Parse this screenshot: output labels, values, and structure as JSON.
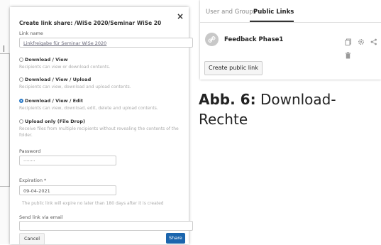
{
  "modal": {
    "title": "Create link share: /WiSe 2020/Seminar WiSe 20",
    "close_glyph": "×",
    "link_name_label": "Link name",
    "link_name_value": "Linkfreigabe für Seminar WiSe 2020",
    "options": [
      {
        "name": "Download / View",
        "desc": "Recipients can view or download contents.",
        "selected": false
      },
      {
        "name": "Download / View / Upload",
        "desc": "Recipients can view, download and upload contents.",
        "selected": false
      },
      {
        "name": "Download / View / Edit",
        "desc": "Recipients can view, download, edit, delete and upload contents.",
        "selected": true
      },
      {
        "name": "Upload only (File Drop)",
        "desc": "Receive files from multiple recipients without revealing the contents of the folder.",
        "selected": false
      }
    ],
    "password_label": "Password",
    "password_value": "········",
    "expiration_label": "Expiration *",
    "expiration_value": "09-04-2021",
    "expiration_hint": "The public link will expire no later than 180 days after it is created",
    "email_label": "Send link via email",
    "email_value": "",
    "cancel_label": "Cancel",
    "share_label": "Share"
  },
  "panel": {
    "tabs": [
      "User and Groups",
      "Public Links"
    ],
    "active_tab": "Public Links",
    "links": [
      {
        "name": "Feedback Phase1"
      }
    ],
    "action_icons": [
      "copy-icon",
      "gear-icon",
      "share-icon",
      "trash-icon"
    ],
    "create_label": "Create public link"
  },
  "caption": {
    "prefix": "Abb. 6:",
    "text": " Download-Rechte"
  },
  "colors": {
    "accent": "#1b65ad",
    "radio_selected": "#2a7ac8",
    "avatar": "#c8c8c8"
  }
}
